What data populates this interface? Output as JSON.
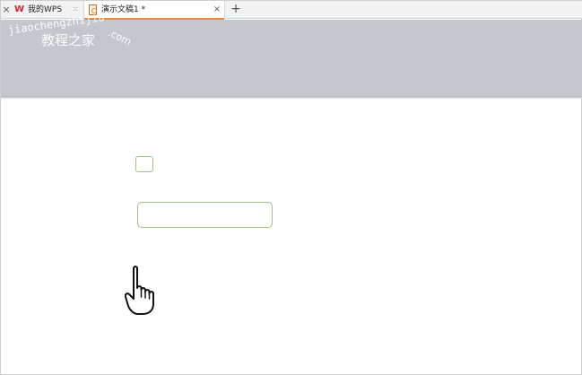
{
  "tabs": {
    "home_label": "我的WPS",
    "doc_label": "演示文稿1 *",
    "close_symbol": "×",
    "new_tab_symbol": "+",
    "grip_symbol": "⁙"
  },
  "watermark": {
    "line1": "jiaochengzhijia",
    "line2": "教程之家",
    "domain": ".com"
  },
  "icons": {
    "wps_logo": "W",
    "doc_icon": "presentation-doc-icon",
    "cursor": "hand-pointer-icon"
  },
  "colors": {
    "accent_tab": "#e68a3c",
    "control_border": "#9cc285",
    "ribbon_bg": "#c4c7ce"
  }
}
